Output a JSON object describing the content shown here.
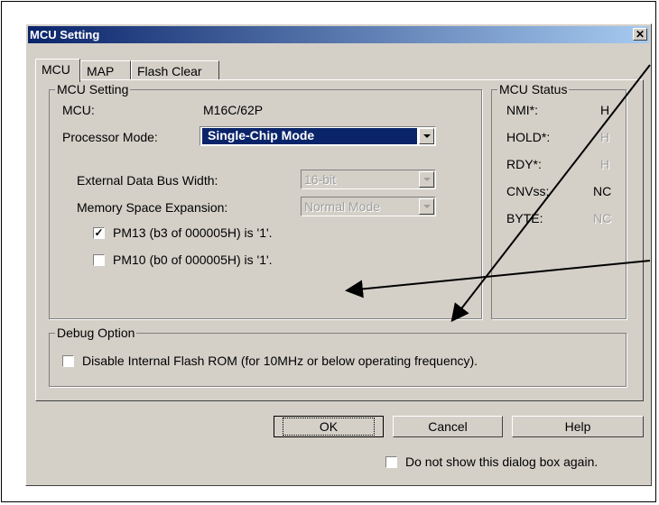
{
  "window": {
    "title": "MCU Setting",
    "close_glyph": "✕"
  },
  "tabs": [
    {
      "label": "MCU",
      "active": true
    },
    {
      "label": "MAP",
      "active": false
    },
    {
      "label": "Flash Clear",
      "active": false
    }
  ],
  "mcu_setting": {
    "group_label": "MCU Setting",
    "mcu_label": "MCU:",
    "mcu_value": "M16C/62P",
    "processor_mode_label": "Processor Mode:",
    "processor_mode_value": "Single-Chip Mode",
    "ext_bus_label": "External Data Bus Width:",
    "ext_bus_value": "16-bit",
    "mem_exp_label": "Memory Space Expansion:",
    "mem_exp_value": "Normal Mode",
    "pm13_label": "PM13 (b3 of 000005H) is '1'.",
    "pm13_checked": true,
    "pm10_label": "PM10 (b0 of 000005H) is '1'.",
    "pm10_checked": false
  },
  "mcu_status": {
    "group_label": "MCU Status",
    "rows": [
      {
        "name": "NMI*:",
        "value": "H",
        "enabled": true
      },
      {
        "name": "HOLD*:",
        "value": "H",
        "enabled": false
      },
      {
        "name": "RDY*:",
        "value": "H",
        "enabled": false
      },
      {
        "name": "CNVss:",
        "value": "NC",
        "enabled": true
      },
      {
        "name": "BYTE:",
        "value": "NC",
        "enabled": false
      }
    ]
  },
  "debug_option": {
    "group_label": "Debug Option",
    "disable_flash_label": "Disable Internal Flash ROM (for 10MHz or below operating frequency).",
    "disable_flash_checked": false
  },
  "buttons": {
    "ok": "OK",
    "cancel": "Cancel",
    "help": "Help"
  },
  "footer": {
    "dont_show_label": "Do not show this dialog box again.",
    "dont_show_checked": false
  },
  "check_glyph": "✓"
}
